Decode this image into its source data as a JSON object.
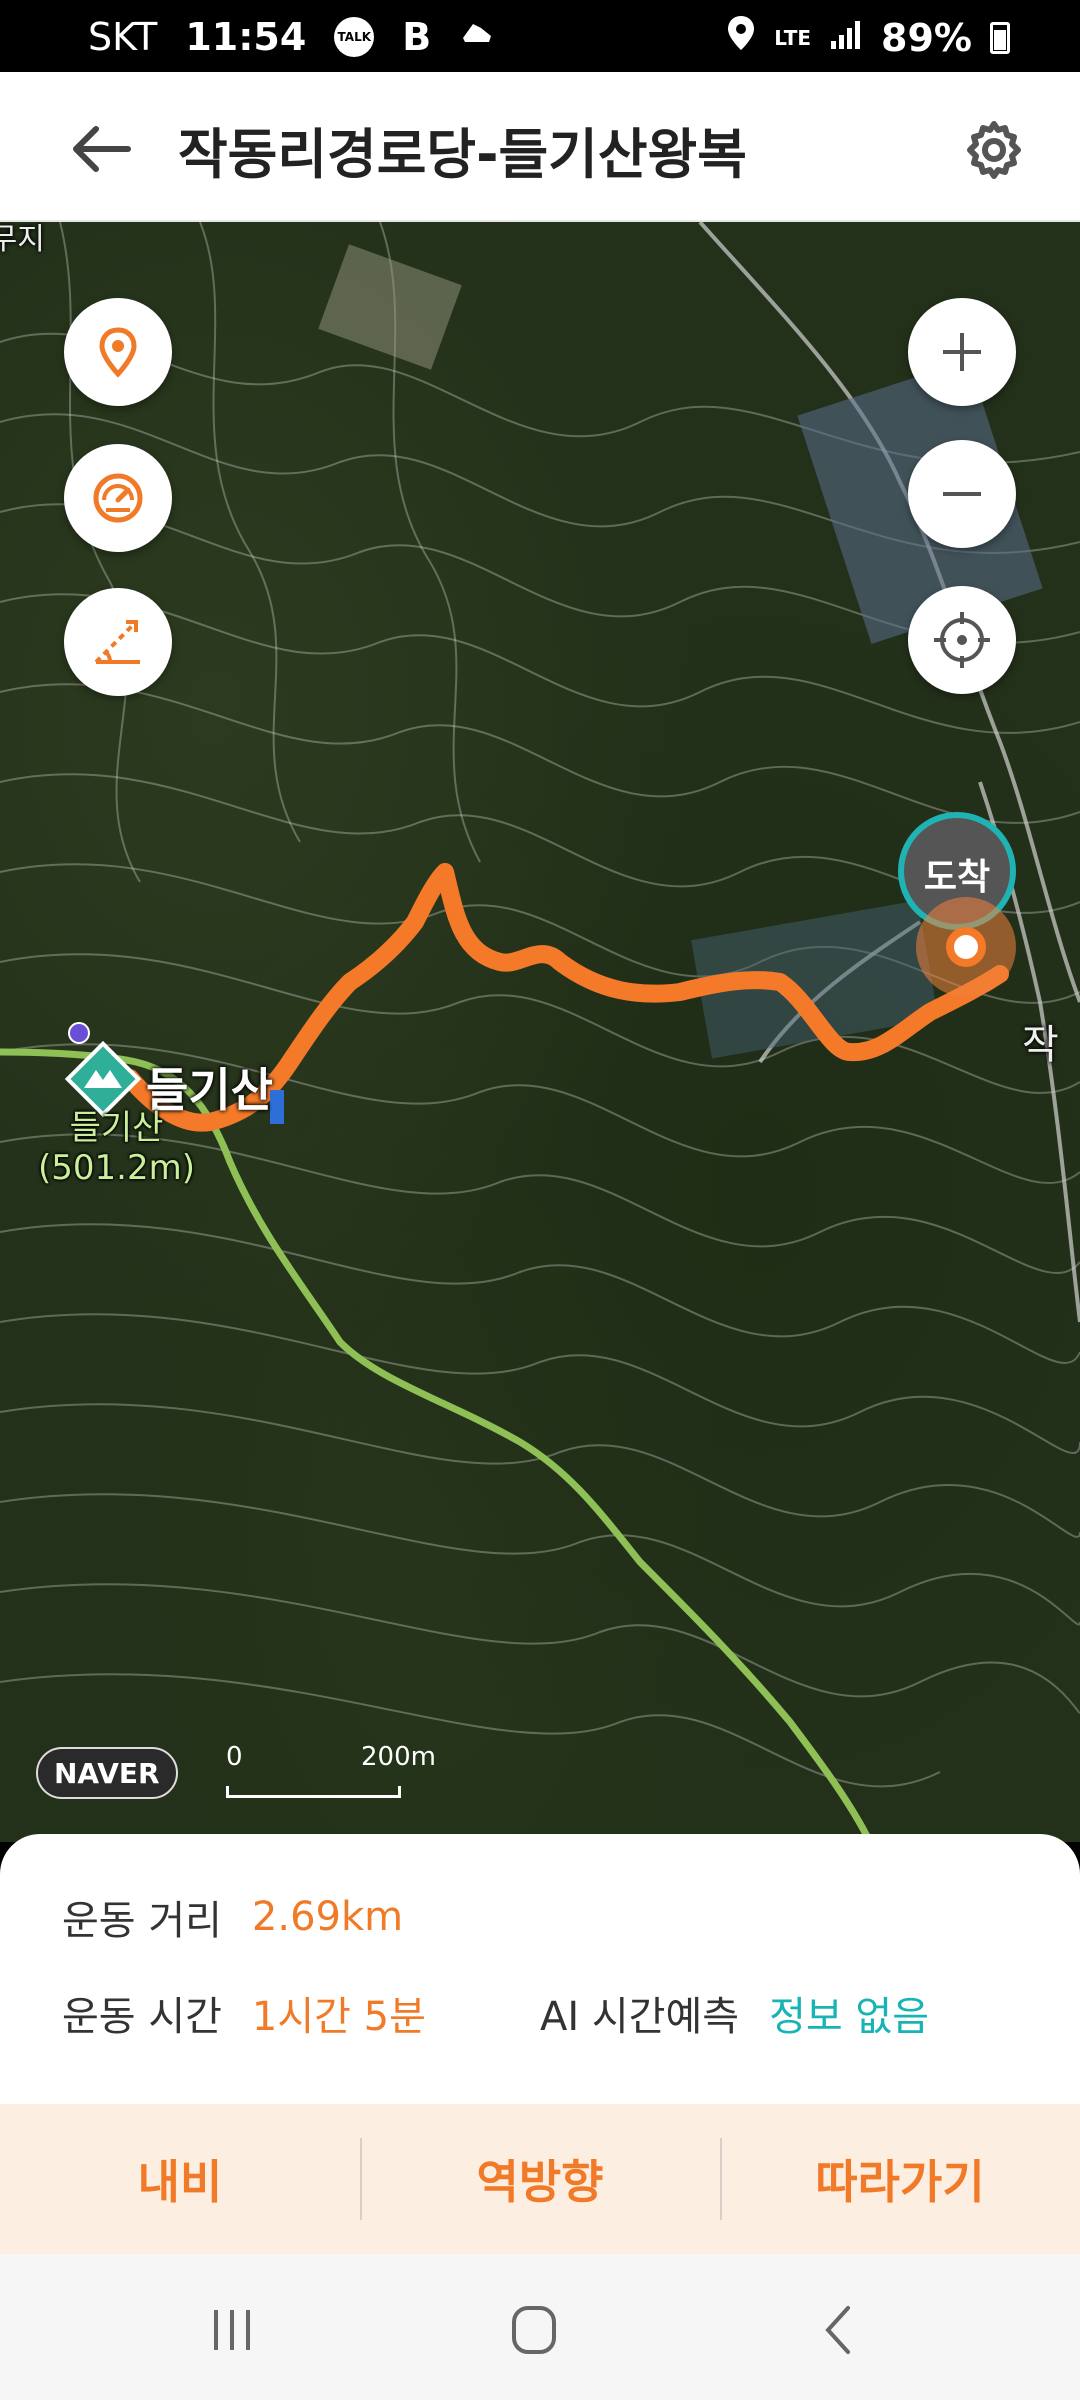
{
  "status_bar": {
    "carrier": "SKT",
    "time": "11:54",
    "notif_talk": "TALK",
    "notif_b": "B",
    "network": "LTE",
    "battery": "89%"
  },
  "app_bar": {
    "title": "작동리경로당-들기산왕복"
  },
  "map": {
    "peak_name": "들기산",
    "summit_name": "들기산",
    "summit_elevation": "(501.2m)",
    "destination_badge": "도착",
    "edge_label_right": "작",
    "edge_label_top": "나무지",
    "provider": "NAVER",
    "scale_zero": "0",
    "scale_length": "200m"
  },
  "info": {
    "distance_label": "운동 거리",
    "distance_value": "2.69km",
    "time_label": "운동 시간",
    "time_value": "1시간 5분",
    "ai_label": "AI 시간예측",
    "ai_value": "정보 없음"
  },
  "actions": {
    "navigate": "내비",
    "reverse": "역방향",
    "follow": "따라가기"
  },
  "colors": {
    "accent": "#f07a28",
    "teal": "#18b3b5",
    "route": "#f47a2a",
    "trail": "#8ec056"
  }
}
